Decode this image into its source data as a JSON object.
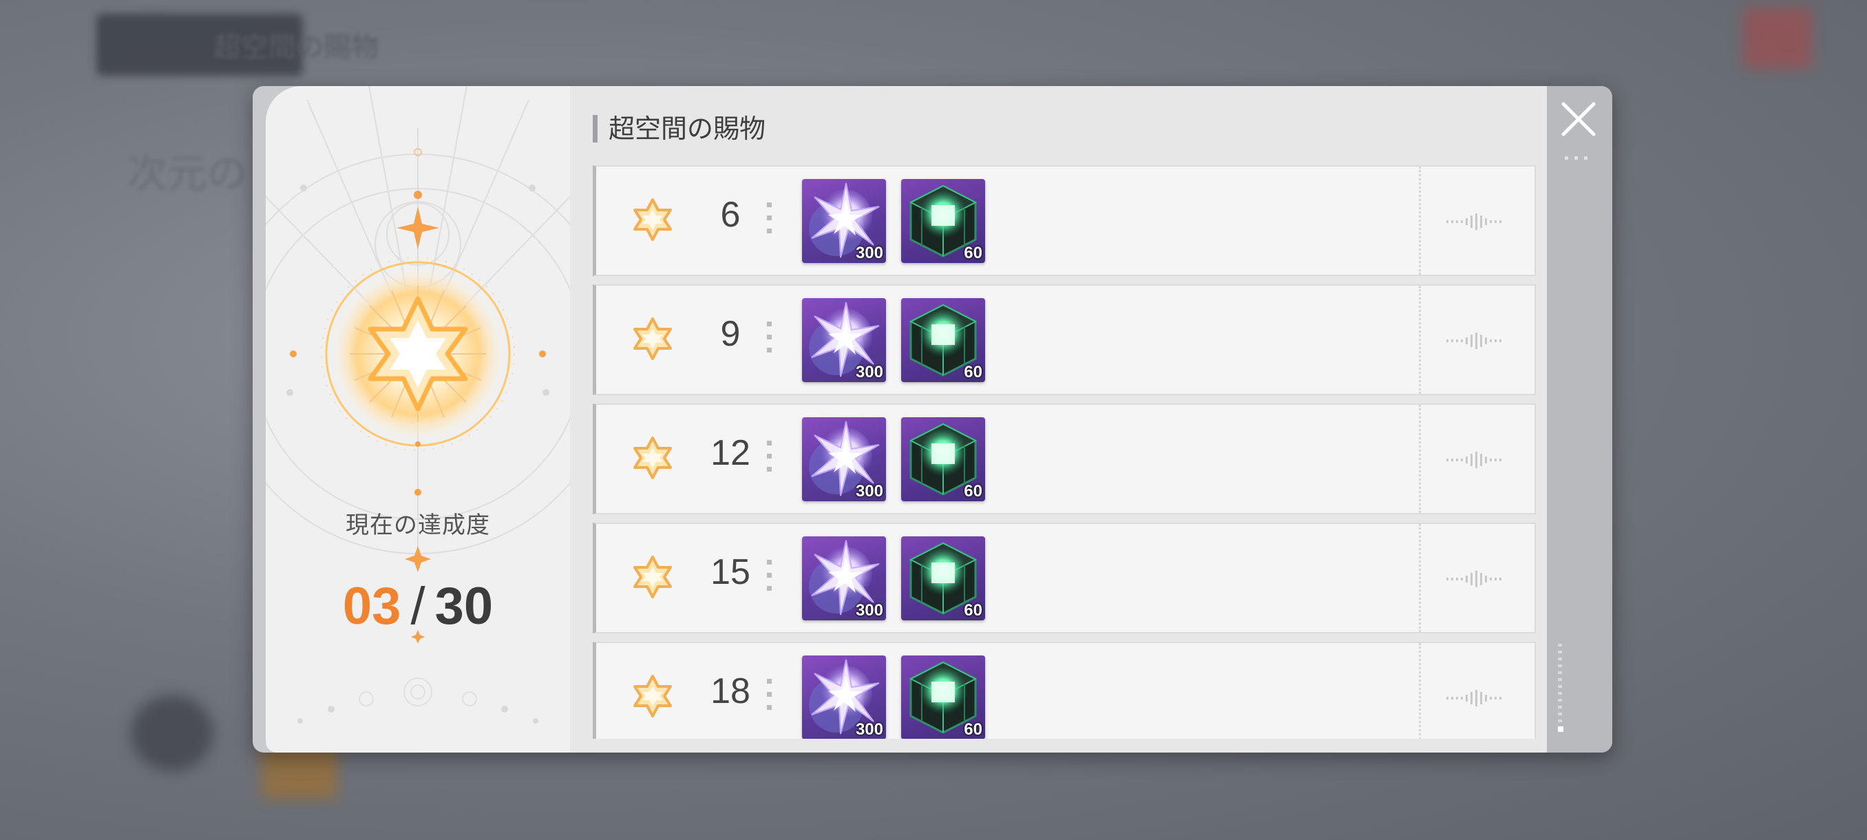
{
  "background": {
    "title": "超空間の賜物",
    "subtitle": "次元の"
  },
  "left_panel": {
    "progress_label": "現在の達成度",
    "current": "03",
    "separator": "/",
    "total": "30",
    "accent_color": "#f0832f"
  },
  "rewards": {
    "title": "超空間の賜物",
    "rows": [
      {
        "threshold": "6",
        "items": [
          {
            "icon": "crystal-star-icon",
            "qty": "300"
          },
          {
            "icon": "green-cube-icon",
            "qty": "60"
          }
        ]
      },
      {
        "threshold": "9",
        "items": [
          {
            "icon": "crystal-star-icon",
            "qty": "300"
          },
          {
            "icon": "green-cube-icon",
            "qty": "60"
          }
        ]
      },
      {
        "threshold": "12",
        "items": [
          {
            "icon": "crystal-star-icon",
            "qty": "300"
          },
          {
            "icon": "green-cube-icon",
            "qty": "60"
          }
        ]
      },
      {
        "threshold": "15",
        "items": [
          {
            "icon": "crystal-star-icon",
            "qty": "300"
          },
          {
            "icon": "green-cube-icon",
            "qty": "60"
          }
        ]
      },
      {
        "threshold": "18",
        "items": [
          {
            "icon": "crystal-star-icon",
            "qty": "300"
          },
          {
            "icon": "green-cube-icon",
            "qty": "60"
          }
        ]
      }
    ]
  },
  "icons": {
    "close": "close-icon",
    "star": "star-badge-icon",
    "status": "waveform-icon"
  }
}
